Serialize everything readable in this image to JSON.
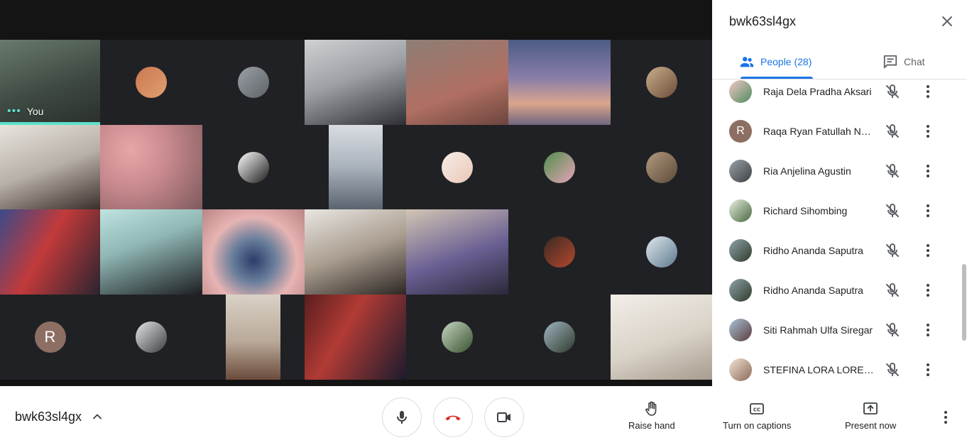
{
  "meeting": {
    "code": "bwk63sl4gx"
  },
  "stage": {
    "self_label": "You",
    "tiles": [
      {
        "kind": "video",
        "bg": "linear-gradient(160deg,#6a7a6e 0%,#3e4a42 55%,#2a2f2b 100%)",
        "self": true
      },
      {
        "kind": "avatar",
        "avatar_bg": "linear-gradient(135deg,#c9784f,#e0a070)"
      },
      {
        "kind": "avatar",
        "avatar_bg": "linear-gradient(135deg,#9aa0a6,#5f6368)"
      },
      {
        "kind": "video",
        "bg": "linear-gradient(160deg,#cfd2d4 0%,#9da1a5 45%,#2e2e33 100%)"
      },
      {
        "kind": "video",
        "bg": "linear-gradient(160deg,#8d7e76 0%,#b06f62 60%,#6b453e 100%)"
      },
      {
        "kind": "video",
        "bg": "linear-gradient(180deg,#4b5b86 0%,#8a7ea8 45%,#d9a58c 75%,#6f6680 100%)"
      },
      {
        "kind": "avatar",
        "avatar_bg": "linear-gradient(135deg,#c8b08a,#6d4b3a)"
      },
      {
        "kind": "video",
        "bg": "linear-gradient(160deg,#e8e4de 0%,#b7b0a6 50%,#3a2e2a 100%)"
      },
      {
        "kind": "video",
        "bg": "radial-gradient(circle at 30% 30%,#e6a6a9,#c98a8f 40%,#7e5a5c 100%)"
      },
      {
        "kind": "avatar",
        "avatar_bg": "linear-gradient(135deg,#ffffff,#1b1b1b)"
      },
      {
        "kind": "video",
        "bg": "linear-gradient(180deg,#d9dde2 0%,#a9b2bb 50%,#5a6470 100%)"
      },
      {
        "kind": "avatar",
        "avatar_bg": "linear-gradient(135deg,#f6eee8,#e9c7b5)"
      },
      {
        "kind": "avatar",
        "avatar_bg": "linear-gradient(135deg,#4e8f4b,#e9a3b8)"
      },
      {
        "kind": "avatar",
        "avatar_bg": "linear-gradient(135deg,#b49a7f,#5c4a3a)"
      },
      {
        "kind": "video",
        "bg": "linear-gradient(120deg,#3b4b8a 0%,#c23a3a 45%,#2a2430 100%)"
      },
      {
        "kind": "video",
        "bg": "linear-gradient(160deg,#bfe3e0 0%,#8fb7b4 40%,#1e1e22 100%)"
      },
      {
        "kind": "video",
        "bg": "radial-gradient(circle at 50% 60%,#2a3d6b 0%,#6a7f9c 30%,#e7b4b3 60%,#b98484 100%)"
      },
      {
        "kind": "video",
        "bg": "linear-gradient(160deg,#e9e6e1 0%,#a99d8f 50%,#2d2724 100%)"
      },
      {
        "kind": "video",
        "bg": "linear-gradient(160deg,#d2c6b4 0%,#6a5f93 55%,#2c2838 100%)"
      },
      {
        "kind": "avatar",
        "avatar_bg": "linear-gradient(135deg,#3a2a22,#b5472f)"
      },
      {
        "kind": "avatar",
        "avatar_bg": "linear-gradient(135deg,#dfe7ee,#5e7a8e)"
      },
      {
        "kind": "letter",
        "letter": "R"
      },
      {
        "kind": "avatar",
        "avatar_bg": "linear-gradient(135deg,#e3e6e8,#3c3f42)"
      },
      {
        "kind": "video",
        "bg": "linear-gradient(180deg,#d9d2c6 0%,#b9a999 55%,#6b4b3b 100%)",
        "narrow": true
      },
      {
        "kind": "video",
        "bg": "linear-gradient(120deg,#5a1e1e 0%,#b23b35 40%,#1b1b2d 100%)"
      },
      {
        "kind": "avatar",
        "avatar_bg": "linear-gradient(135deg,#c7d6c1,#37512f)"
      },
      {
        "kind": "avatar",
        "avatar_bg": "linear-gradient(135deg,#9fb4c0,#2e3a2b)"
      },
      {
        "kind": "video",
        "bg": "linear-gradient(160deg,#f2eee8 0%,#d9d2c7 55%,#a69c8f 100%)"
      }
    ]
  },
  "panel": {
    "title": "bwk63sl4gx",
    "tabs": {
      "people_label": "People (28)",
      "chat_label": "Chat"
    },
    "people": [
      {
        "name": "Raja Dela Pradha Aksari",
        "avatar_bg": "linear-gradient(135deg,#f3c9c9,#4e8a5d)"
      },
      {
        "name": "Raqa Ryan Fatullah Nasution",
        "letter": "R"
      },
      {
        "name": "Ria Anjelina Agustin",
        "avatar_bg": "linear-gradient(135deg,#9aa0a6,#3c4043)"
      },
      {
        "name": "Richard Sihombing",
        "avatar_bg": "linear-gradient(135deg,#e9efe2,#47663d)"
      },
      {
        "name": "Ridho Ananda Saputra",
        "avatar_bg": "linear-gradient(135deg,#8fa3a8,#2e3a2b)"
      },
      {
        "name": "Ridho Ananda Saputra",
        "avatar_bg": "linear-gradient(135deg,#8fa3a8,#2e3a2b)"
      },
      {
        "name": "Siti Rahmah Ulfa Siregar",
        "avatar_bg": "linear-gradient(135deg,#a9c4d9,#5b3b3b)"
      },
      {
        "name": "STEFINA LORA LORENZA",
        "avatar_bg": "linear-gradient(135deg,#f1e3d6,#8a6a55)"
      }
    ]
  },
  "controls": {
    "raise_hand_label": "Raise hand",
    "captions_label": "Turn on captions",
    "present_label": "Present now"
  },
  "colors": {
    "accent": "#1a73e8",
    "speaking": "#5ce1c9",
    "hangup": "#d93025"
  }
}
